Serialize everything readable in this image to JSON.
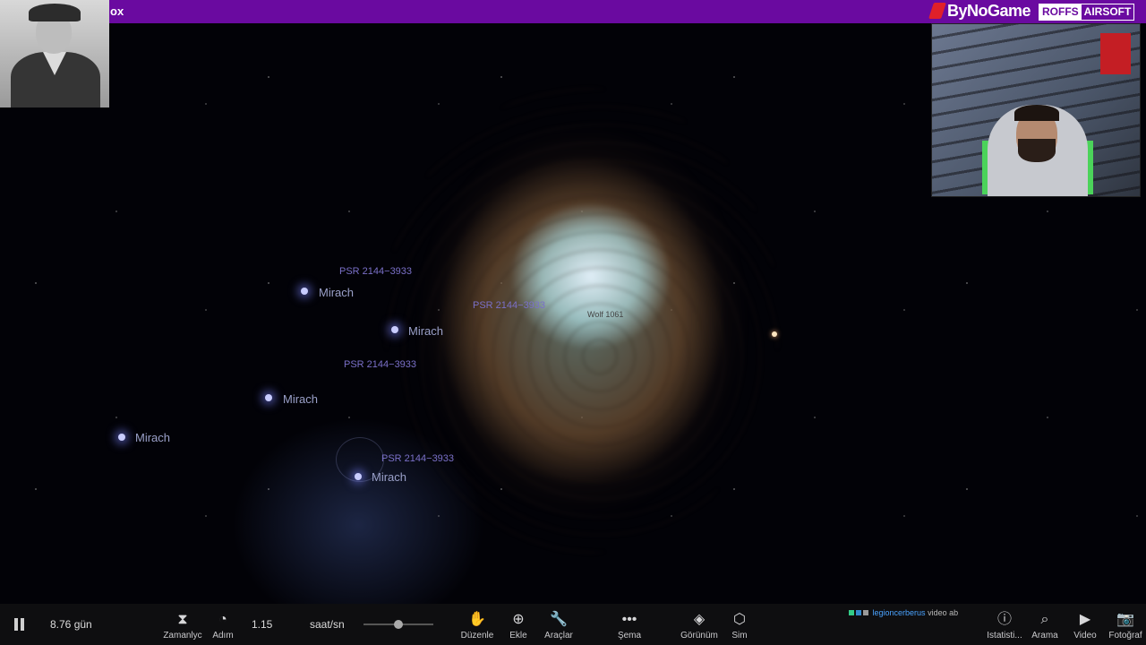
{
  "header": {
    "title_fragment": "ox",
    "brand": "ByNoGame",
    "sponsor_left": "ROFFS",
    "sponsor_right": "AIRSOFT"
  },
  "sky": {
    "labels": [
      {
        "kind": "psr",
        "text": "PSR 2144−3933"
      },
      {
        "kind": "mirach",
        "text": "Mirach"
      },
      {
        "kind": "psr",
        "text": "PSR 2144−3933"
      },
      {
        "kind": "mirach",
        "text": "Mirach"
      },
      {
        "kind": "psr",
        "text": "PSR 2144−3933"
      },
      {
        "kind": "mirach",
        "text": "Mirach"
      },
      {
        "kind": "mirach",
        "text": "Mirach"
      },
      {
        "kind": "psr",
        "text": "PSR 2144−3933"
      },
      {
        "kind": "mirach",
        "text": "Mirach"
      },
      {
        "kind": "wolf",
        "text": "Wolf 1061"
      }
    ]
  },
  "toolbar": {
    "time_value": "8.76 gün",
    "speed_value": "1.15",
    "speed_unit": "saat/sn",
    "buttons": {
      "timer": "Zamanlyc",
      "step": "Adım",
      "edit": "Düzenle",
      "add": "Ekle",
      "tools": "Araçlar",
      "schema": "Şema",
      "view": "Görünüm",
      "sim": "Sim",
      "stats": "Istatisti...",
      "search": "Arama",
      "video": "Video",
      "photo": "Fotoğraf"
    },
    "chat": {
      "user": "legioncerberus",
      "message": "video ab"
    }
  }
}
